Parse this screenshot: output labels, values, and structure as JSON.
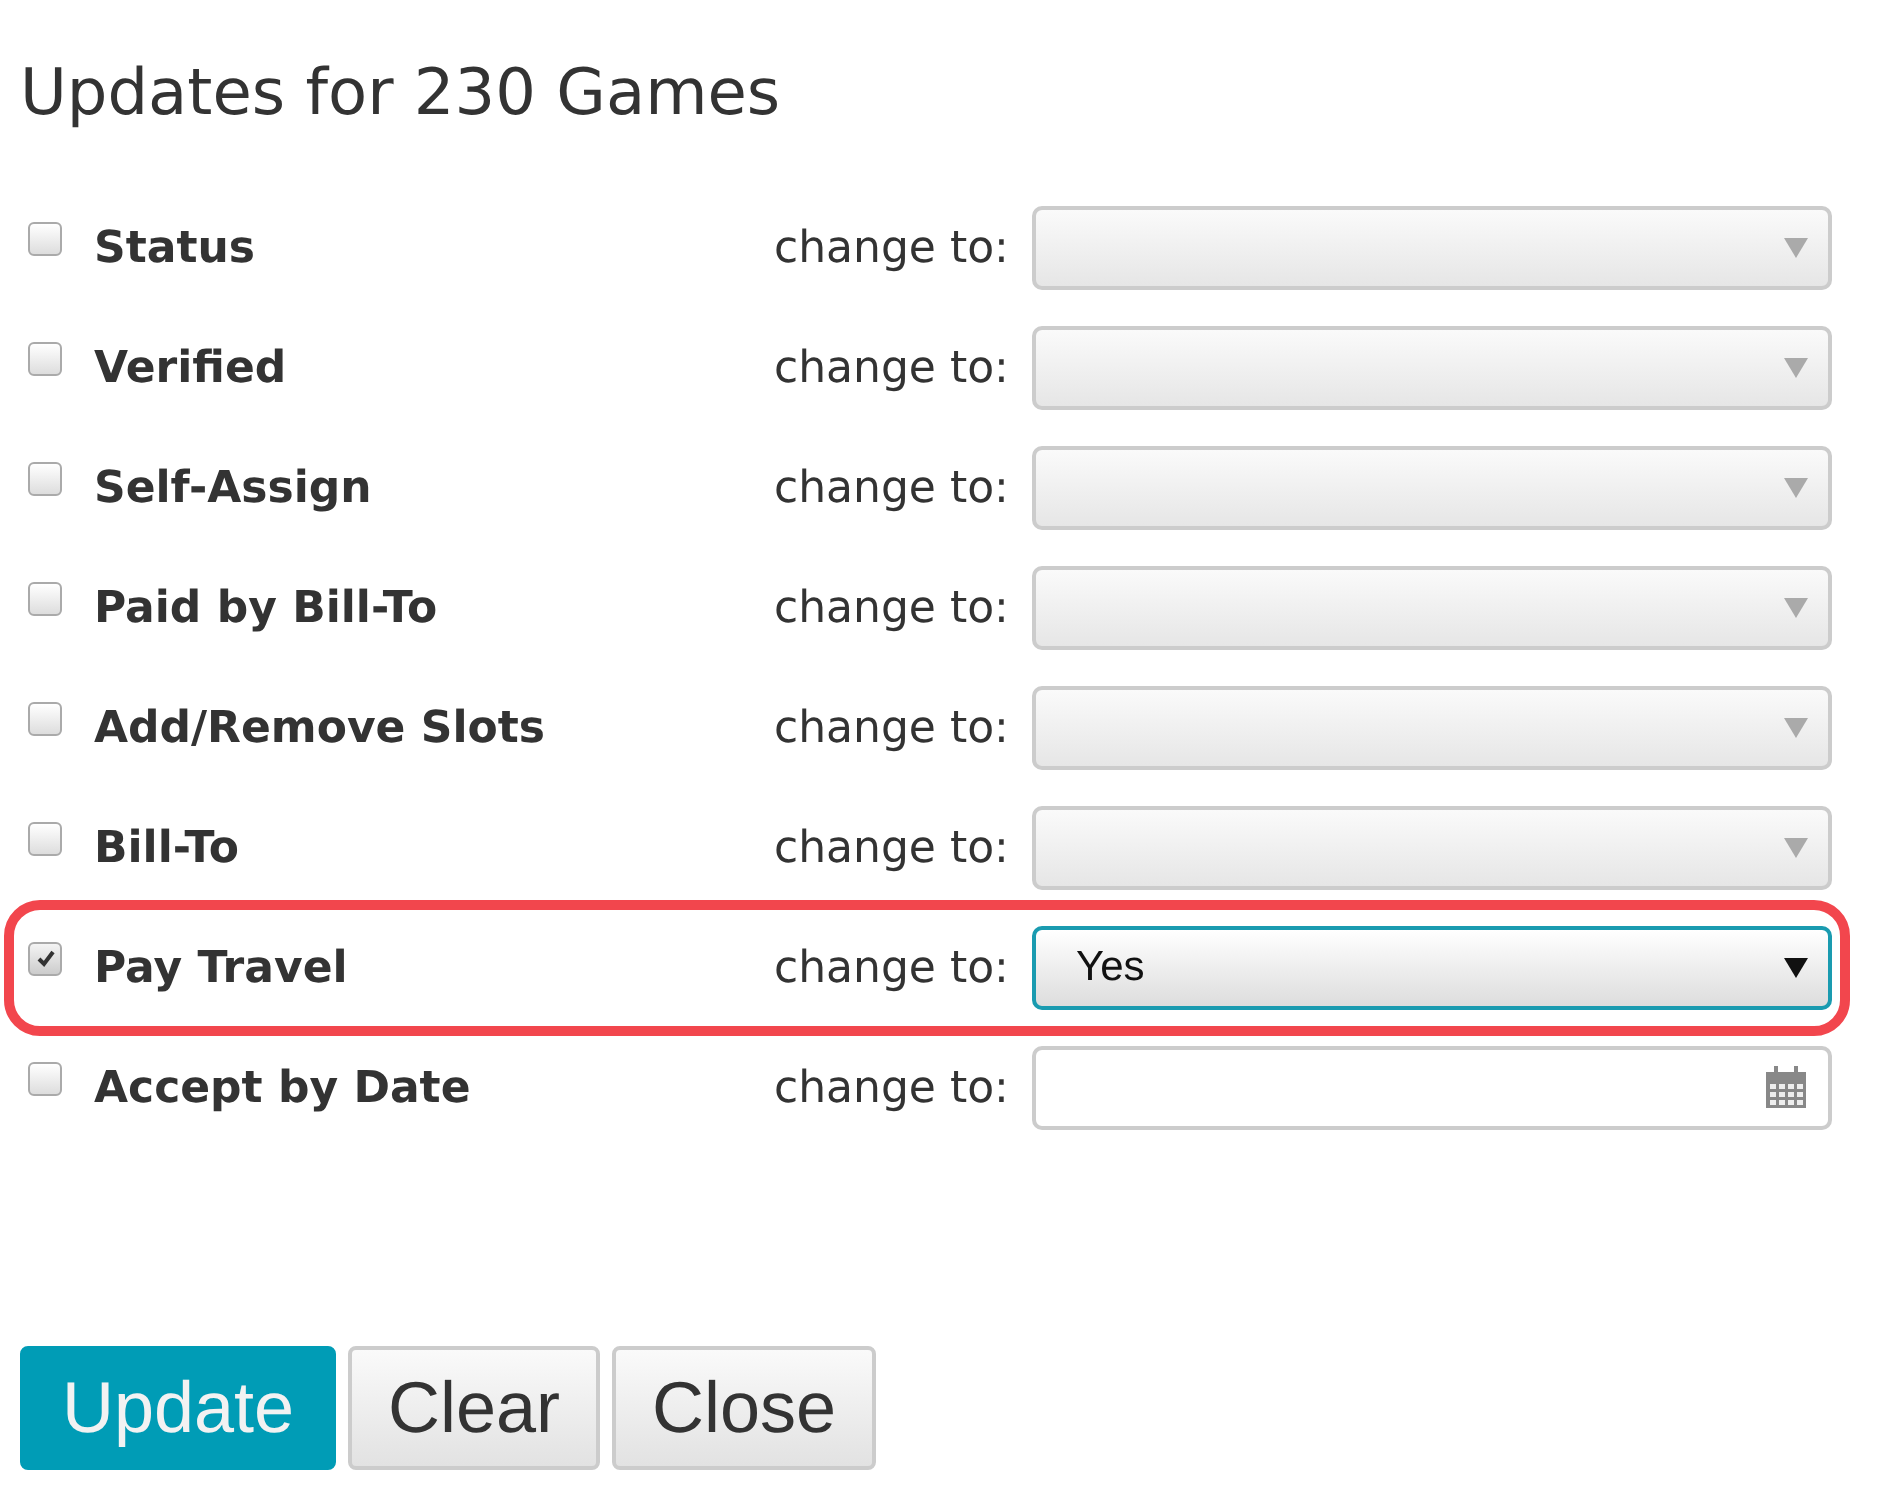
{
  "title": "Updates for 230 Games",
  "rows": [
    {
      "label": "Status",
      "checked": false,
      "prompt": "change to:",
      "kind": "select",
      "highlighted": false
    },
    {
      "label": "Verified",
      "checked": false,
      "prompt": "change to:",
      "kind": "select",
      "highlighted": false
    },
    {
      "label": "Self-Assign",
      "checked": false,
      "prompt": "change to:",
      "kind": "select",
      "highlighted": false
    },
    {
      "label": "Paid by Bill-To",
      "checked": false,
      "prompt": "change to:",
      "kind": "select",
      "highlighted": false
    },
    {
      "label": "Add/Remove Slots",
      "checked": false,
      "prompt": "change to:",
      "kind": "select",
      "highlighted": false
    },
    {
      "label": "Bill-To",
      "checked": false,
      "prompt": "change to:",
      "kind": "select",
      "highlighted": false
    },
    {
      "label": "Pay Travel",
      "checked": true,
      "prompt": "change to:",
      "kind": "select",
      "value": "Yes",
      "highlighted": true
    },
    {
      "label": "Accept by Date",
      "checked": false,
      "prompt": "change to:",
      "kind": "date",
      "highlighted": false
    }
  ],
  "buttons": [
    {
      "label": "Update",
      "kind": "primary"
    },
    {
      "label": "Clear",
      "kind": "default"
    },
    {
      "label": "Close",
      "kind": "default"
    }
  ]
}
